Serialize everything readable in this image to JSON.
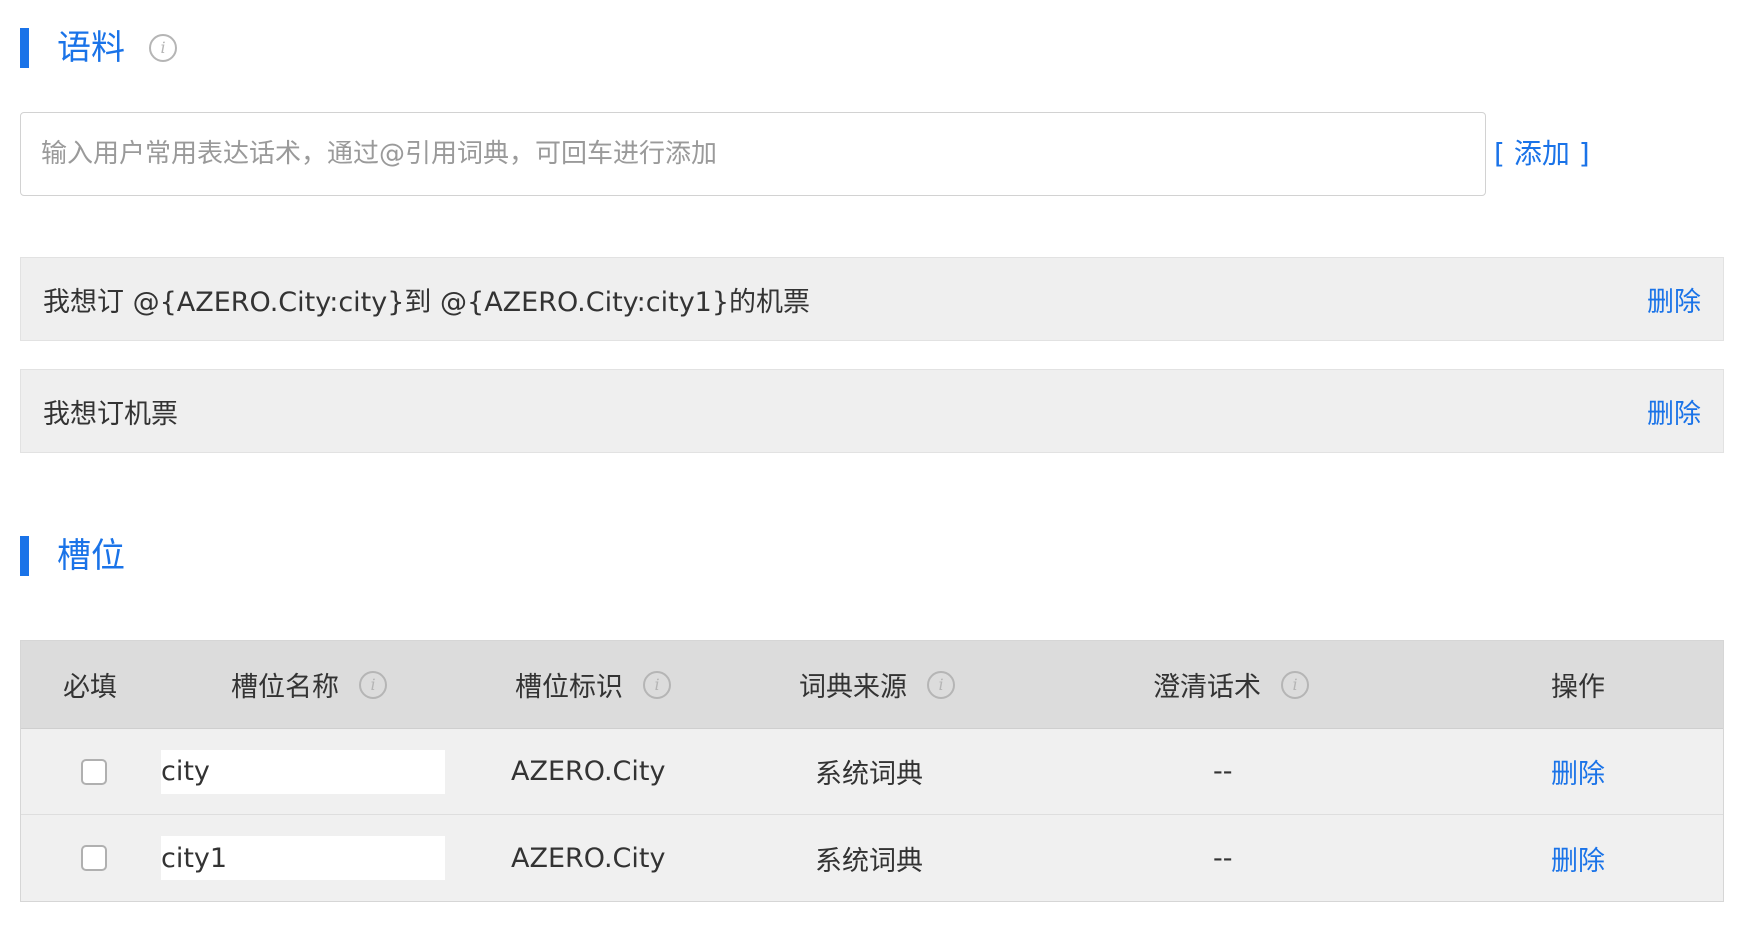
{
  "corpus": {
    "title": "语料",
    "info_icon": "info-icon",
    "input_placeholder": "输入用户常用表达话术，通过@引用词典，可回车进行添加",
    "input_value": "",
    "add_label": "[ 添加 ]",
    "items": [
      {
        "text": "我想订 @{AZERO.City:city}到 @{AZERO.City:city1}的机票",
        "delete_label": "删除"
      },
      {
        "text": "我想订机票",
        "delete_label": "删除"
      }
    ]
  },
  "slots": {
    "title": "槽位",
    "columns": {
      "required": "必填",
      "name": "槽位名称",
      "identifier": "槽位标识",
      "dict_source": "词典来源",
      "clarify": "澄清话术",
      "action": "操作"
    },
    "rows": [
      {
        "required": false,
        "name": "city",
        "identifier": "AZERO.City",
        "dict_source": "系统词典",
        "clarify": "--",
        "action": "删除"
      },
      {
        "required": false,
        "name": "city1",
        "identifier": "AZERO.City",
        "dict_source": "系统词典",
        "clarify": "--",
        "action": "删除"
      }
    ]
  },
  "colors": {
    "accent": "#1a73e8",
    "row_background": "#efefef",
    "header_background": "#dcdcdc"
  }
}
